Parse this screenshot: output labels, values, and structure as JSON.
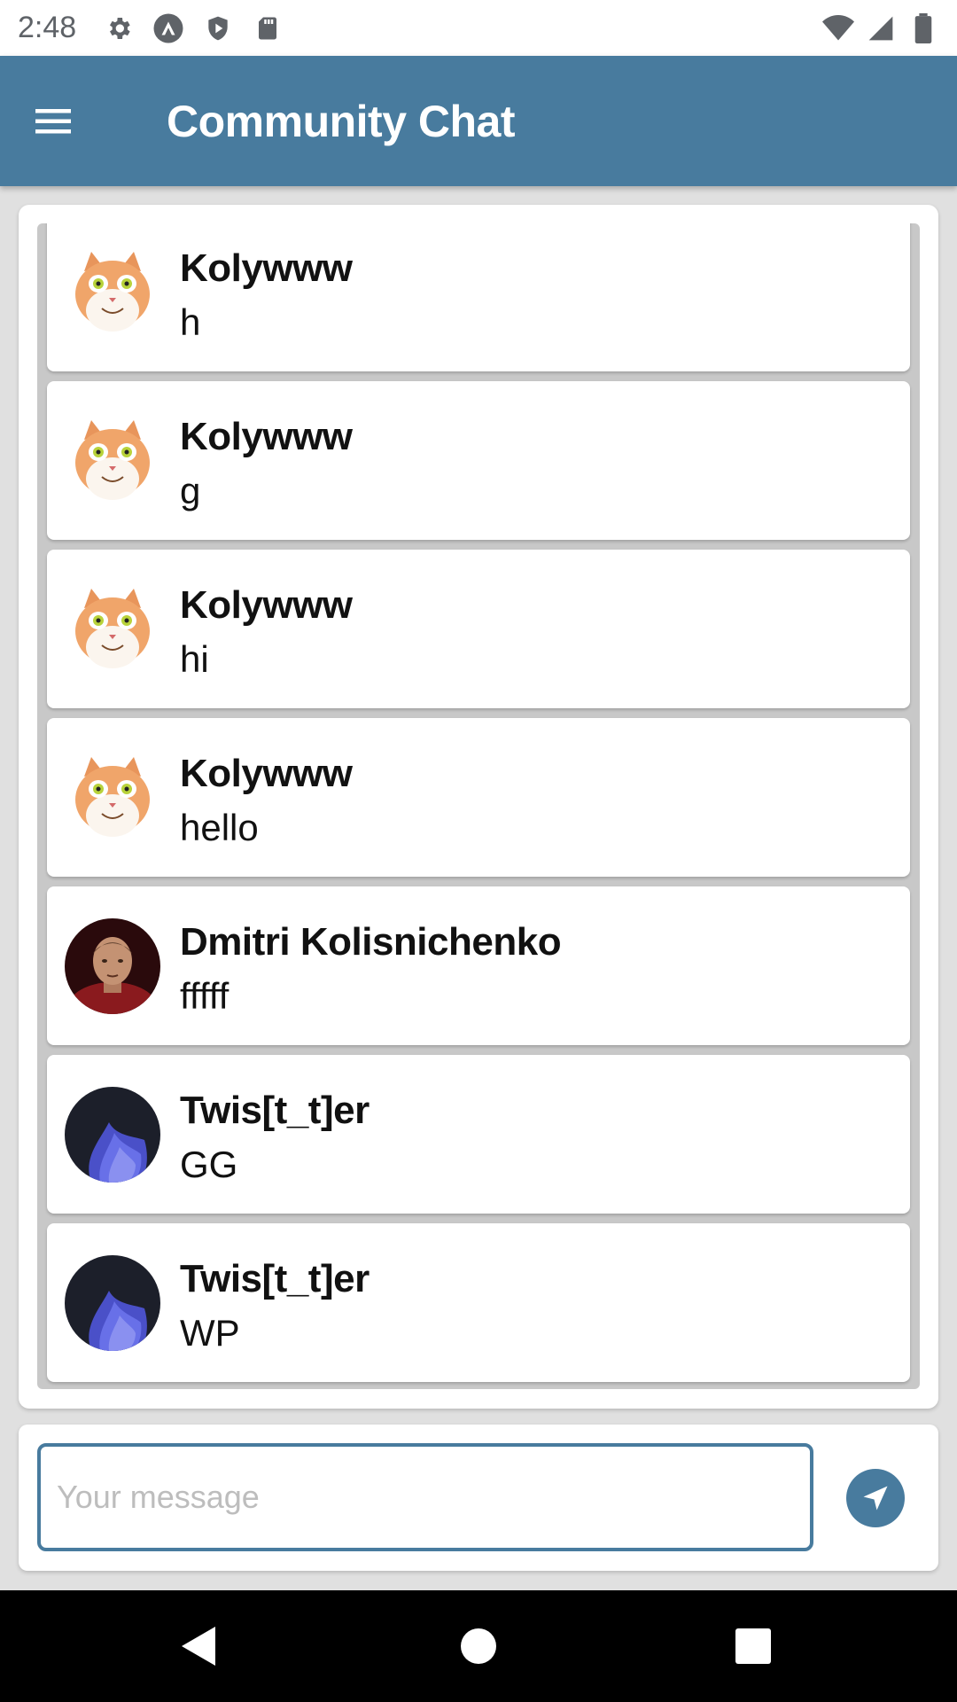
{
  "status_bar": {
    "time": "2:48",
    "left_icons": [
      "gear-icon",
      "a-logo-icon",
      "shield-play-icon",
      "sd-card-icon"
    ],
    "right_icons": [
      "wifi-icon",
      "cell-signal-icon",
      "battery-icon"
    ]
  },
  "app_bar": {
    "title": "Community Chat",
    "menu_icon": "hamburger-menu-icon",
    "color": "#487b9e"
  },
  "messages": [
    {
      "author": "Kolywww",
      "text": "h",
      "avatar": "cat-avatar"
    },
    {
      "author": "Kolywww",
      "text": "g",
      "avatar": "cat-avatar"
    },
    {
      "author": "Kolywww",
      "text": "hi",
      "avatar": "cat-avatar"
    },
    {
      "author": "Kolywww",
      "text": "hello",
      "avatar": "cat-avatar"
    },
    {
      "author": "Dmitri Kolisnichenko",
      "text": "fffff",
      "avatar": "man-avatar"
    },
    {
      "author": "Twis[t_t]er",
      "text": "GG",
      "avatar": "blue-abstract-avatar"
    },
    {
      "author": "Twis[t_t]er",
      "text": "WP",
      "avatar": "blue-abstract-avatar"
    }
  ],
  "composer": {
    "placeholder": "Your message",
    "value": "",
    "send_icon": "send-arrow-icon"
  },
  "nav_bar": {
    "icons": [
      "back-icon",
      "home-icon",
      "recents-icon"
    ]
  }
}
